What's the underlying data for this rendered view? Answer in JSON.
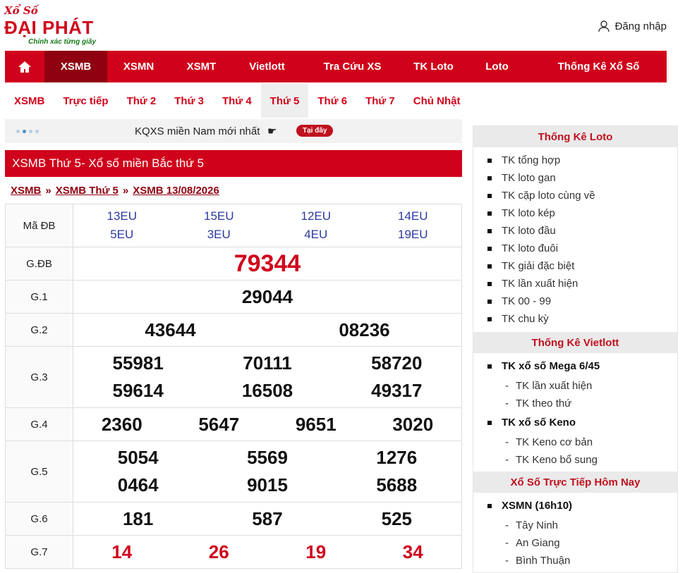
{
  "logo": {
    "line1": "Xổ Số",
    "line2": "ĐẠI PHÁT",
    "line3": "Chính xác từng giây"
  },
  "login": {
    "label": "Đăng nhập"
  },
  "main_nav": [
    "XSMB",
    "XSMN",
    "XSMT",
    "Vietlott",
    "Tra Cứu XS",
    "TK Loto",
    "Loto",
    "Thống Kê Xổ Số"
  ],
  "sub_nav": [
    "XSMB",
    "Trực tiếp",
    "Thứ 2",
    "Thứ 3",
    "Thứ 4",
    "Thứ 5",
    "Thứ 6",
    "Thứ 7",
    "Chủ Nhật"
  ],
  "ticker": {
    "text": "KQXS miền Nam mới nhất",
    "badge": "Tại đây"
  },
  "results": {
    "title": "XSMB Thứ 5- Xổ số miền Bắc thứ 5",
    "breadcrumb": [
      "XSMB",
      "XSMB Thứ 5",
      "XSMB 13/08/2026"
    ],
    "labels": {
      "ma_db": "Mã ĐB",
      "gdb": "G.ĐB",
      "g1": "G.1",
      "g2": "G.2",
      "g3": "G.3",
      "g4": "G.4",
      "g5": "G.5",
      "g6": "G.6",
      "g7": "G.7"
    },
    "ma_db": [
      "13EU",
      "15EU",
      "12EU",
      "14EU",
      "5EU",
      "3EU",
      "4EU",
      "19EU"
    ],
    "gdb": "79344",
    "g1": "29044",
    "g2": [
      "43644",
      "08236"
    ],
    "g3": [
      "55981",
      "70111",
      "58720",
      "59614",
      "16508",
      "49317"
    ],
    "g4": [
      "2360",
      "5647",
      "9651",
      "3020"
    ],
    "g5": [
      "5054",
      "5569",
      "1276",
      "0464",
      "9015",
      "5688"
    ],
    "g6": [
      "181",
      "587",
      "525"
    ],
    "g7": [
      "14",
      "26",
      "19",
      "34"
    ]
  },
  "sidebar": {
    "loto_title": "Thống Kê Loto",
    "loto_items": [
      "TK tổng hợp",
      "TK loto gan",
      "TK cặp loto cùng về",
      "TK loto kép",
      "TK loto đầu",
      "TK loto đuôi",
      "TK giải đặc biệt",
      "TK lần xuất hiện",
      "TK 00 - 99",
      "TK chu kỳ"
    ],
    "vietlott_title": "Thống Kê Vietlott",
    "mega_title": "TK xổ số Mega 6/45",
    "mega_items": [
      "TK lần xuất hiện",
      "TK theo thứ"
    ],
    "keno_title": "TK xổ số Keno",
    "keno_items": [
      "TK Keno cơ bản",
      "TK Keno bổ sung"
    ],
    "live_title": "Xổ Số Trực Tiếp Hôm Nay",
    "xsmn_title": "XSMN (16h10)",
    "xsmn_items": [
      "Tây Ninh",
      "An Giang",
      "Bình Thuận"
    ]
  },
  "colors": {
    "brand_red": "#d0021b",
    "active_dark_red": "#8f0010",
    "code_blue": "#2a3a9f"
  }
}
